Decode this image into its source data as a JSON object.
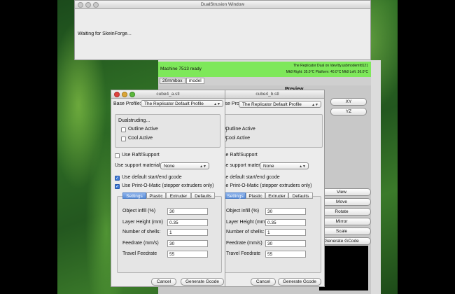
{
  "dualstrusion_window": {
    "title": "DualStrusion Window",
    "message": "Waiting for SkeinForge..."
  },
  "control_panel": {
    "status": "Machine 7513 ready",
    "machine_info": "The Replicator Dual on /dev/tty.usbmodemfd121",
    "temps": "Mk8 Right: 35.0°C  Platform: 40.0°C  Mk8 Left: 36.0°C",
    "tabs": [
      "20mmbox",
      "model"
    ],
    "preview_label": "Preview",
    "view_buttons": [
      "XY",
      "YZ"
    ],
    "side_buttons": [
      "View",
      "Move",
      "Rotate",
      "Mirror",
      "Scale",
      "Generate GCode"
    ]
  },
  "front_dialog": {
    "title": "cube4_a.stl",
    "base_profile_label": "Base Profile:",
    "base_profile_value": "The Replicator Default Profile",
    "dualstruding_label": "Dualstruding...",
    "outline_active": "Outline Active",
    "cool_active": "Cool Active",
    "use_raft": "Use Raft/Support",
    "support_material_label": "Use support material",
    "support_material_value": "None",
    "use_default_gcode": "Use default start/end gcode",
    "use_print_o_matic": "Use Print-O-Matic (stepper extruders only)",
    "tabs": [
      "Settings",
      "Plastic",
      "Extruder",
      "Defaults"
    ],
    "fields": [
      {
        "label": "Object infill (%)",
        "value": "30"
      },
      {
        "label": "Layer Height (mm)",
        "value": "0.35"
      },
      {
        "label": "Number of shells:",
        "value": "1"
      },
      {
        "label": "Feedrate (mm/s)",
        "value": "30"
      },
      {
        "label": "Travel Feedrate",
        "value": "55"
      }
    ],
    "cancel": "Cancel",
    "generate": "Generate Gcode"
  },
  "back_dialog": {
    "title": "cube4_b.stl",
    "base_profile_label": "Base Profile:",
    "base_profile_value": "The Replicator Default Profile",
    "outline_active": "Outline Active",
    "cool_active": "Cool Active",
    "use_raft": "Use Raft/Support",
    "support_material_label": "Use support material",
    "support_material_value": "None",
    "use_default_gcode": "Use default start/end gcode",
    "use_print_o_matic": "Use Print-O-Matic (stepper extruders only)",
    "tabs": [
      "Settings",
      "Plastic",
      "Extruder",
      "Defaults"
    ],
    "fields": [
      {
        "label": "Object infill (%)",
        "value": "30"
      },
      {
        "label": "Layer Height (mm)",
        "value": "0.35"
      },
      {
        "label": "Number of shells:",
        "value": "1"
      },
      {
        "label": "Feedrate (mm/s)",
        "value": "30"
      },
      {
        "label": "Travel Feedrate",
        "value": "55"
      }
    ],
    "cancel": "Cancel",
    "generate": "Generate Gcode"
  },
  "colors": {
    "status_green": "#7ee85a",
    "selected_tab": "#5b8ed8",
    "checked_box": "#3d79d6"
  }
}
